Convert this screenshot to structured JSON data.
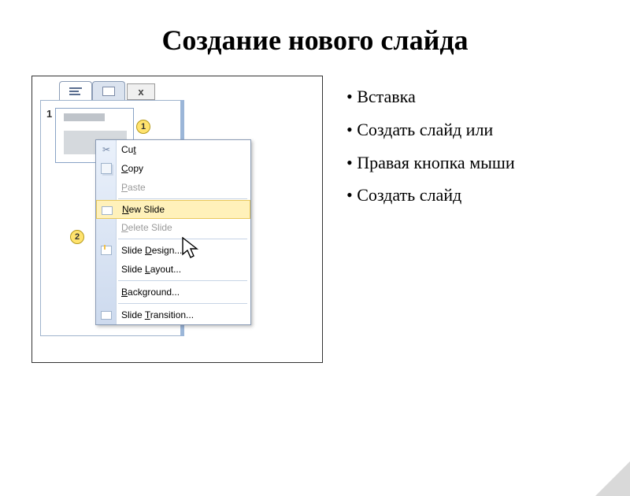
{
  "title": "Создание нового слайда",
  "bullets": [
    "Вставка",
    "Создать слайд или",
    "Правая кнопка мыши",
    "Создать слайд"
  ],
  "markers": {
    "m1": "1",
    "m2": "2"
  },
  "tabs": {
    "close_label": "x"
  },
  "slide_panel": {
    "slide_number": "1"
  },
  "context_menu": {
    "items": [
      {
        "label": "Cut",
        "underline_index": 2,
        "icon": "scissors-icon",
        "disabled": false
      },
      {
        "label": "Copy",
        "underline_index": 0,
        "icon": "copy-icon",
        "disabled": false
      },
      {
        "label": "Paste",
        "underline_index": 0,
        "icon": "",
        "disabled": true
      },
      {
        "sep": true
      },
      {
        "label": "New Slide",
        "underline_index": 0,
        "icon": "new-slide-icon",
        "disabled": false,
        "highlight": true
      },
      {
        "label": "Delete Slide",
        "underline_index": 0,
        "icon": "",
        "disabled": true
      },
      {
        "sep": true
      },
      {
        "label": "Slide Design...",
        "underline_index": 6,
        "icon": "design-icon",
        "disabled": false
      },
      {
        "label": "Slide Layout...",
        "underline_index": 6,
        "icon": "",
        "disabled": false
      },
      {
        "sep": true
      },
      {
        "label": "Background...",
        "underline_index": 0,
        "icon": "",
        "disabled": false
      },
      {
        "sep": true
      },
      {
        "label": "Slide Transition...",
        "underline_index": 6,
        "icon": "transition-icon",
        "disabled": false
      }
    ]
  }
}
